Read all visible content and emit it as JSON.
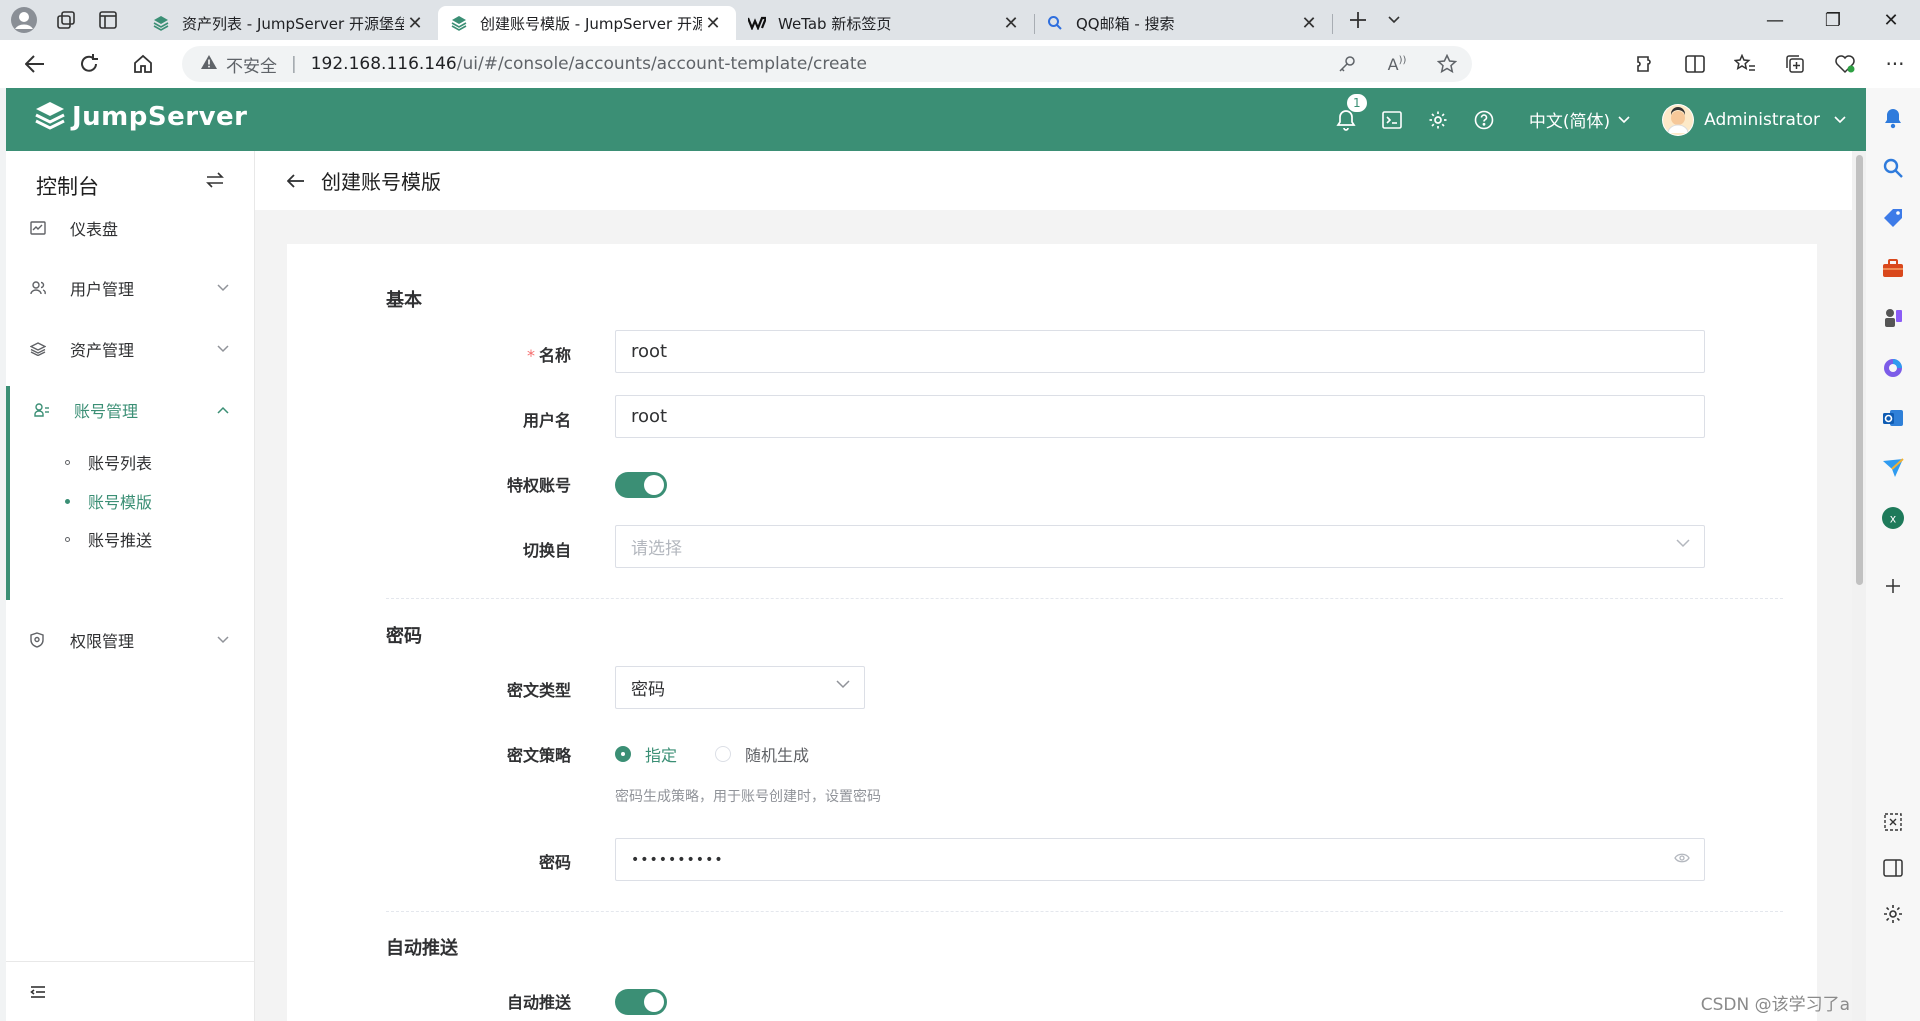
{
  "browser": {
    "tabs": [
      {
        "title": "资产列表 - JumpServer 开源堡垒机",
        "active": false
      },
      {
        "title": "创建账号模版 - JumpServer 开源堡垒机",
        "active": true
      },
      {
        "title": "WeTab 新标签页",
        "active": false
      },
      {
        "title": "QQ邮箱 - 搜索",
        "active": false
      }
    ],
    "insecure_label": "不安全",
    "url_host": "192.168.116.146",
    "url_path": "/ui/#/console/accounts/account-template/create"
  },
  "header": {
    "logo_text": "JumpServer",
    "notification_count": "1",
    "language": "中文(简体)",
    "user_name": "Administrator"
  },
  "menu": {
    "title": "控制台",
    "items": [
      {
        "label": "仪表盘"
      },
      {
        "label": "用户管理"
      },
      {
        "label": "资产管理"
      },
      {
        "label": "账号管理"
      },
      {
        "label": "权限管理"
      }
    ],
    "sub_items": [
      {
        "label": "账号列表"
      },
      {
        "label": "账号模版"
      },
      {
        "label": "账号推送"
      }
    ]
  },
  "page": {
    "title": "创建账号模版"
  },
  "form": {
    "section_basic": "基本",
    "name_label": "名称",
    "name_value": "root",
    "username_label": "用户名",
    "username_value": "root",
    "privileged_label": "特权账号",
    "privileged_on": true,
    "su_from_label": "切换自",
    "su_from_placeholder": "请选择",
    "section_secret": "密码",
    "secret_type_label": "密文类型",
    "secret_type_value": "密码",
    "secret_strategy_label": "密文策略",
    "strategy_options": [
      "指定",
      "随机生成"
    ],
    "strategy_selected": "指定",
    "strategy_help": "密码生成策略，用于账号创建时，设置密码",
    "password_label": "密码",
    "password_value": "••••••••••",
    "section_push": "自动推送",
    "auto_push_label": "自动推送",
    "auto_push_on": true
  },
  "watermark": "CSDN @该学习了a",
  "colors": {
    "brand": "#3b8f75",
    "required": "#f56c6c"
  }
}
